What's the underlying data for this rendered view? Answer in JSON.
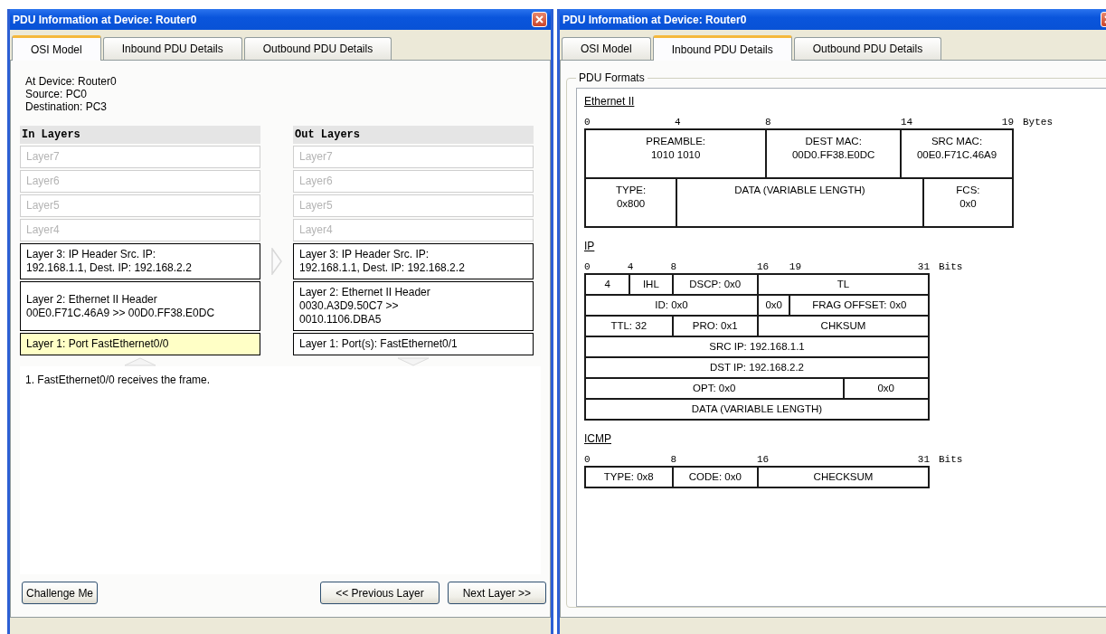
{
  "windows": [
    {
      "kind": "osi",
      "title": "PDU Information at Device: Router0",
      "tabs": [
        {
          "label": "OSI Model",
          "selected": true
        },
        {
          "label": "Inbound PDU Details",
          "selected": false
        },
        {
          "label": "Outbound PDU Details",
          "selected": false
        }
      ],
      "info": [
        "At Device: Router0",
        "Source: PC0",
        "Destination: PC3"
      ],
      "layer_columns": [
        {
          "heading": "In Layers",
          "layers": [
            {
              "lines": [
                "Layer7"
              ],
              "disabled": true,
              "selected": false
            },
            {
              "lines": [
                "Layer6"
              ],
              "disabled": true,
              "selected": false
            },
            {
              "lines": [
                "Layer5"
              ],
              "disabled": true,
              "selected": false
            },
            {
              "lines": [
                "Layer4"
              ],
              "disabled": true,
              "selected": false
            },
            {
              "lines": [
                "Layer 3: IP Header Src. IP:",
                "192.168.1.1, Dest. IP: 192.168.2.2"
              ],
              "disabled": false,
              "selected": false
            },
            {
              "lines": [
                "Layer 2: Ethernet II Header",
                "00E0.F71C.46A9 >> 00D0.FF38.E0DC"
              ],
              "disabled": false,
              "selected": false
            },
            {
              "lines": [
                "Layer 1: Port FastEthernet0/0"
              ],
              "disabled": false,
              "selected": true
            }
          ]
        },
        {
          "heading": "Out Layers",
          "layers": [
            {
              "lines": [
                "Layer7"
              ],
              "disabled": true,
              "selected": false
            },
            {
              "lines": [
                "Layer6"
              ],
              "disabled": true,
              "selected": false
            },
            {
              "lines": [
                "Layer5"
              ],
              "disabled": true,
              "selected": false
            },
            {
              "lines": [
                "Layer4"
              ],
              "disabled": true,
              "selected": false
            },
            {
              "lines": [
                "Layer 3: IP Header Src. IP:",
                "192.168.1.1, Dest. IP: 192.168.2.2"
              ],
              "disabled": false,
              "selected": false
            },
            {
              "lines": [
                "Layer 2: Ethernet II Header",
                "0030.A3D9.50C7 >>",
                "0010.1106.DBA5"
              ],
              "disabled": false,
              "selected": false
            },
            {
              "lines": [
                "Layer 1: Port(s): FastEthernet0/1"
              ],
              "disabled": false,
              "selected": false
            }
          ]
        }
      ],
      "description": "1. FastEthernet0/0 receives the frame.",
      "challenge_button": "Challenge Me",
      "nav_buttons": [
        "<< Previous Layer",
        "Next Layer >>"
      ]
    },
    {
      "kind": "pdu",
      "title": "PDU Information at Device: Router0",
      "tabs": [
        {
          "label": "OSI Model",
          "selected": false
        },
        {
          "label": "Inbound PDU Details",
          "selected": true
        },
        {
          "label": "Outbound PDU Details",
          "selected": false
        }
      ],
      "group_title": "PDU Formats",
      "formats": [
        {
          "kind": "ethernet",
          "name": "Ethernet II",
          "ticks": [
            "0",
            "4",
            "8",
            "14",
            "19"
          ],
          "unit": "Bytes",
          "field_lines": [
            [
              [
                "PREAMBLE:",
                "1010 1010"
              ],
              [
                "DEST MAC:",
                "00D0.FF38.E0DC"
              ],
              [
                "SRC MAC:",
                "00E0.F71C.46A9"
              ]
            ],
            [
              [
                "TYPE:",
                "0x800"
              ],
              [
                "DATA (VARIABLE LENGTH)"
              ],
              [
                "FCS:",
                "0x0"
              ]
            ]
          ]
        },
        {
          "kind": "ip",
          "name": "IP",
          "ticks": [
            "0",
            "4",
            "8",
            "16",
            "19",
            "31"
          ],
          "unit": "Bits",
          "field_lines": [
            [
              [
                "4"
              ],
              [
                "IHL"
              ],
              [
                "DSCP: 0x0"
              ],
              [
                "TL"
              ]
            ],
            [
              [
                "ID: 0x0"
              ],
              [
                "0x0"
              ],
              [
                "FRAG OFFSET: 0x0"
              ]
            ],
            [
              [
                "TTL: 32"
              ],
              [
                "PRO: 0x1"
              ],
              [
                "CHKSUM"
              ]
            ],
            [
              [
                "SRC IP: 192.168.1.1"
              ]
            ],
            [
              [
                "DST IP: 192.168.2.2"
              ]
            ],
            [
              [
                "OPT: 0x0"
              ],
              [
                "0x0"
              ]
            ],
            [
              [
                "DATA (VARIABLE LENGTH)"
              ]
            ]
          ]
        },
        {
          "kind": "icmp",
          "name": "ICMP",
          "ticks": [
            "0",
            "8",
            "16",
            "31"
          ],
          "unit": "Bits",
          "field_lines": [
            [
              [
                "TYPE: 0x8"
              ],
              [
                "CODE: 0x0"
              ],
              [
                "CHECKSUM"
              ]
            ]
          ]
        }
      ]
    }
  ]
}
